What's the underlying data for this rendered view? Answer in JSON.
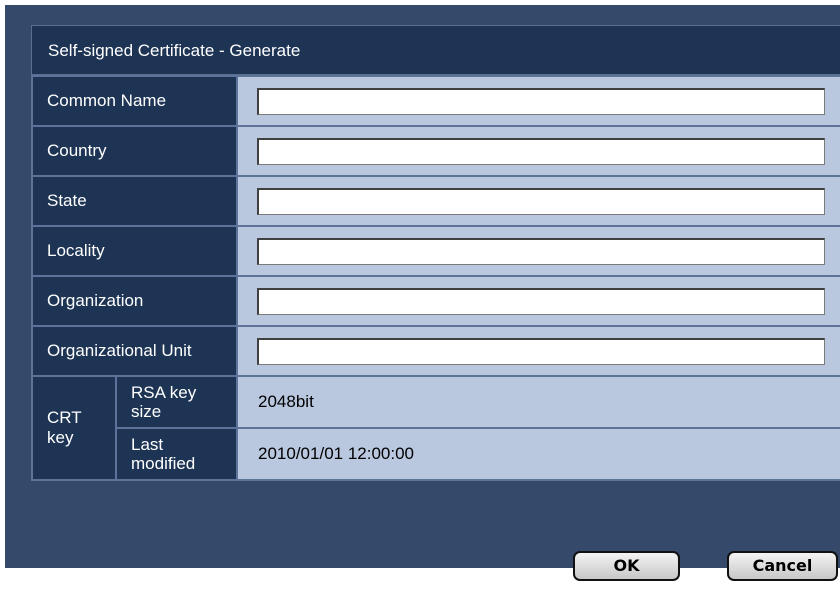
{
  "dialog": {
    "title": "Self-signed Certificate - Generate"
  },
  "fields": [
    {
      "label": "Common Name",
      "value": ""
    },
    {
      "label": "Country",
      "value": ""
    },
    {
      "label": "State",
      "value": ""
    },
    {
      "label": "Locality",
      "value": ""
    },
    {
      "label": "Organization",
      "value": ""
    },
    {
      "label": "Organizational Unit",
      "value": ""
    }
  ],
  "crt_key": {
    "label_line1": "CRT",
    "label_line2": "key",
    "rsa_label_line1": "RSA key",
    "rsa_label_line2": "size",
    "rsa_value": "2048bit",
    "modified_label_line1": "Last",
    "modified_label_line2": "modified",
    "modified_value": "2010/01/01 12:00:00"
  },
  "buttons": {
    "ok": "OK",
    "cancel": "Cancel"
  },
  "colors": {
    "background": "#35496b",
    "label_cell": "#1e3454",
    "value_cell": "#b9c7df"
  }
}
